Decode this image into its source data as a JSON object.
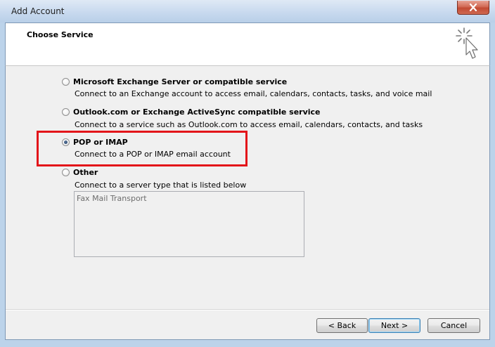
{
  "window": {
    "title": "Add Account"
  },
  "header": {
    "title": "Choose Service"
  },
  "options": [
    {
      "label": "Microsoft Exchange Server or compatible service",
      "description": "Connect to an Exchange account to access email, calendars, contacts, tasks, and voice mail",
      "selected": false
    },
    {
      "label": "Outlook.com or Exchange ActiveSync compatible service",
      "description": "Connect to a service such as Outlook.com to access email, calendars, contacts, and tasks",
      "selected": false
    },
    {
      "label": "POP or IMAP",
      "description": "Connect to a POP or IMAP email account",
      "selected": true
    },
    {
      "label": "Other",
      "description": "Connect to a server type that is listed below",
      "selected": false
    }
  ],
  "other_list": {
    "items": [
      "Fax Mail Transport"
    ]
  },
  "buttons": {
    "back": "< Back",
    "next": "Next >",
    "cancel": "Cancel"
  },
  "colors": {
    "highlight": "#e3151a",
    "close_button": "#c24a33",
    "window_frame": "#bcd3ea"
  }
}
